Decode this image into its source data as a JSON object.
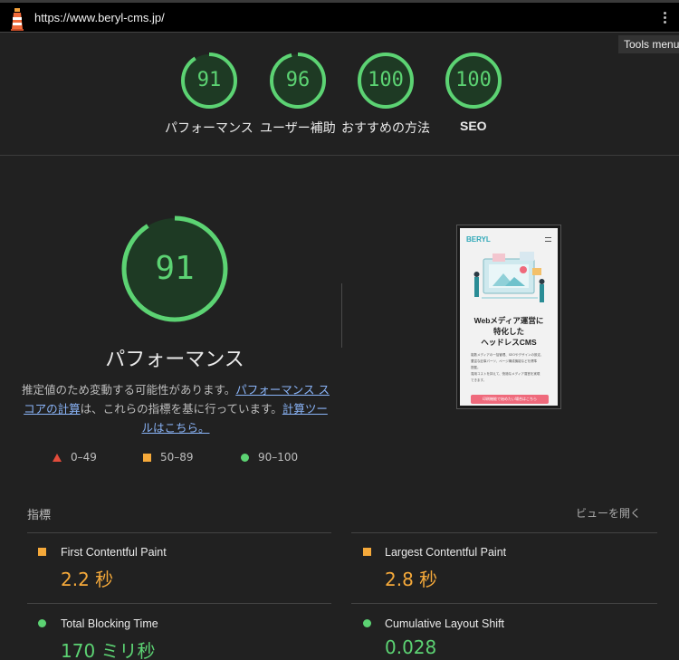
{
  "address_bar": {
    "url": "https://www.beryl-cms.jp/",
    "tools_menu_tooltip": "Tools menu"
  },
  "summary_gauges": [
    {
      "score": "91",
      "label": "パフォーマンス"
    },
    {
      "score": "96",
      "label": "ユーザー補助"
    },
    {
      "score": "100",
      "label": "おすすめの方法"
    },
    {
      "score": "100",
      "label": "SEO"
    }
  ],
  "performance": {
    "score": "91",
    "score_fraction": 0.91,
    "title": "パフォーマンス",
    "desc_prefix": "推定値のため変動する可能性があります。",
    "desc_link1": "パフォーマンス スコアの計算",
    "desc_middle": "は、これらの指標を基に行っています。",
    "desc_link2": "計算ツールはこちら。"
  },
  "legend": {
    "fail": "0–49",
    "average": "50–89",
    "pass": "90–100"
  },
  "screenshot": {
    "logo": "BERYL",
    "headline_1": "Webメディア運営に",
    "headline_2": "特化した",
    "headline_3": "ヘッドレスCMS",
    "body_1": "複数メディアの一括管理、SEOやデザインの設定、",
    "body_2": "豊富な記事パーツ、ページ構成機能などを標準",
    "body_3": "搭載。",
    "body_4": "運用コストを抑えて、快適なメディア運営を実現",
    "body_5": "できます。",
    "cta": "印刷機能で始めたい場合はこちら"
  },
  "metrics_section": {
    "title": "指標",
    "expand_link": "ビューを開く",
    "items": [
      {
        "label": "First Contentful Paint",
        "value": "2.2 秒",
        "status": "average"
      },
      {
        "label": "Largest Contentful Paint",
        "value": "2.8 秒",
        "status": "average"
      },
      {
        "label": "Total Blocking Time",
        "value": "170 ミリ秒",
        "status": "pass"
      },
      {
        "label": "Cumulative Layout Shift",
        "value": "0.028",
        "status": "pass"
      }
    ]
  },
  "colors": {
    "pass": "#5cd373",
    "average": "#f5a93a",
    "fail": "#e24c3b",
    "link": "#8ab4f8"
  }
}
